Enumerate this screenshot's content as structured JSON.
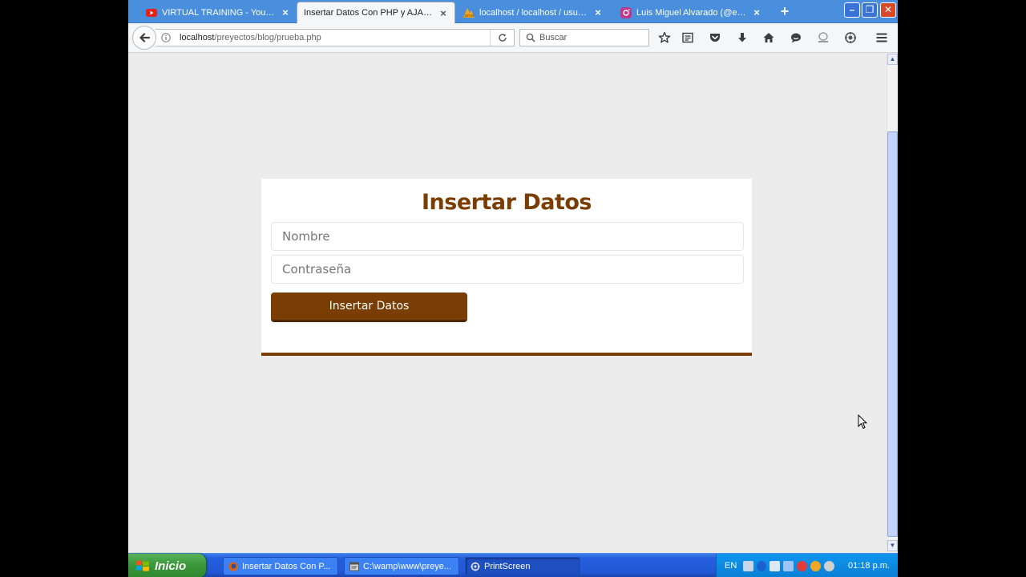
{
  "browser": {
    "tabs": [
      {
        "label": "VIRTUAL TRAINING - YouTube",
        "active": false
      },
      {
        "label": "Insertar Datos Con PHP y AJAX a ...",
        "active": true
      },
      {
        "label": "localhost / localhost / usuario...",
        "active": false
      },
      {
        "label": "Luis Miguel Alvarado (@elcam...",
        "active": false
      }
    ],
    "new_tab_symbol": "+",
    "window_buttons": {
      "minimize": "–",
      "restore": "❐",
      "close": "✕"
    },
    "url_host": "localhost",
    "url_path": "/preyectos/blog/prueba.php",
    "search_placeholder": "Buscar",
    "accent_color": "#4a8fde"
  },
  "page": {
    "title": "Insertar Datos",
    "nombre_placeholder": "Nombre",
    "password_placeholder": "Contraseña",
    "submit_label": "Insertar Datos",
    "brand_color": "#7a3e05",
    "background_color": "#ececec"
  },
  "taskbar": {
    "start_label": "Inicio",
    "tasks": [
      {
        "label": "Insertar Datos Con P...",
        "icon": "firefox-icon"
      },
      {
        "label": "C:\\wamp\\www\\preye...",
        "icon": "editor-icon"
      },
      {
        "label": "PrintScreen",
        "icon": "printscreen-icon"
      }
    ],
    "language": "EN",
    "clock": "01:18 p.m."
  }
}
